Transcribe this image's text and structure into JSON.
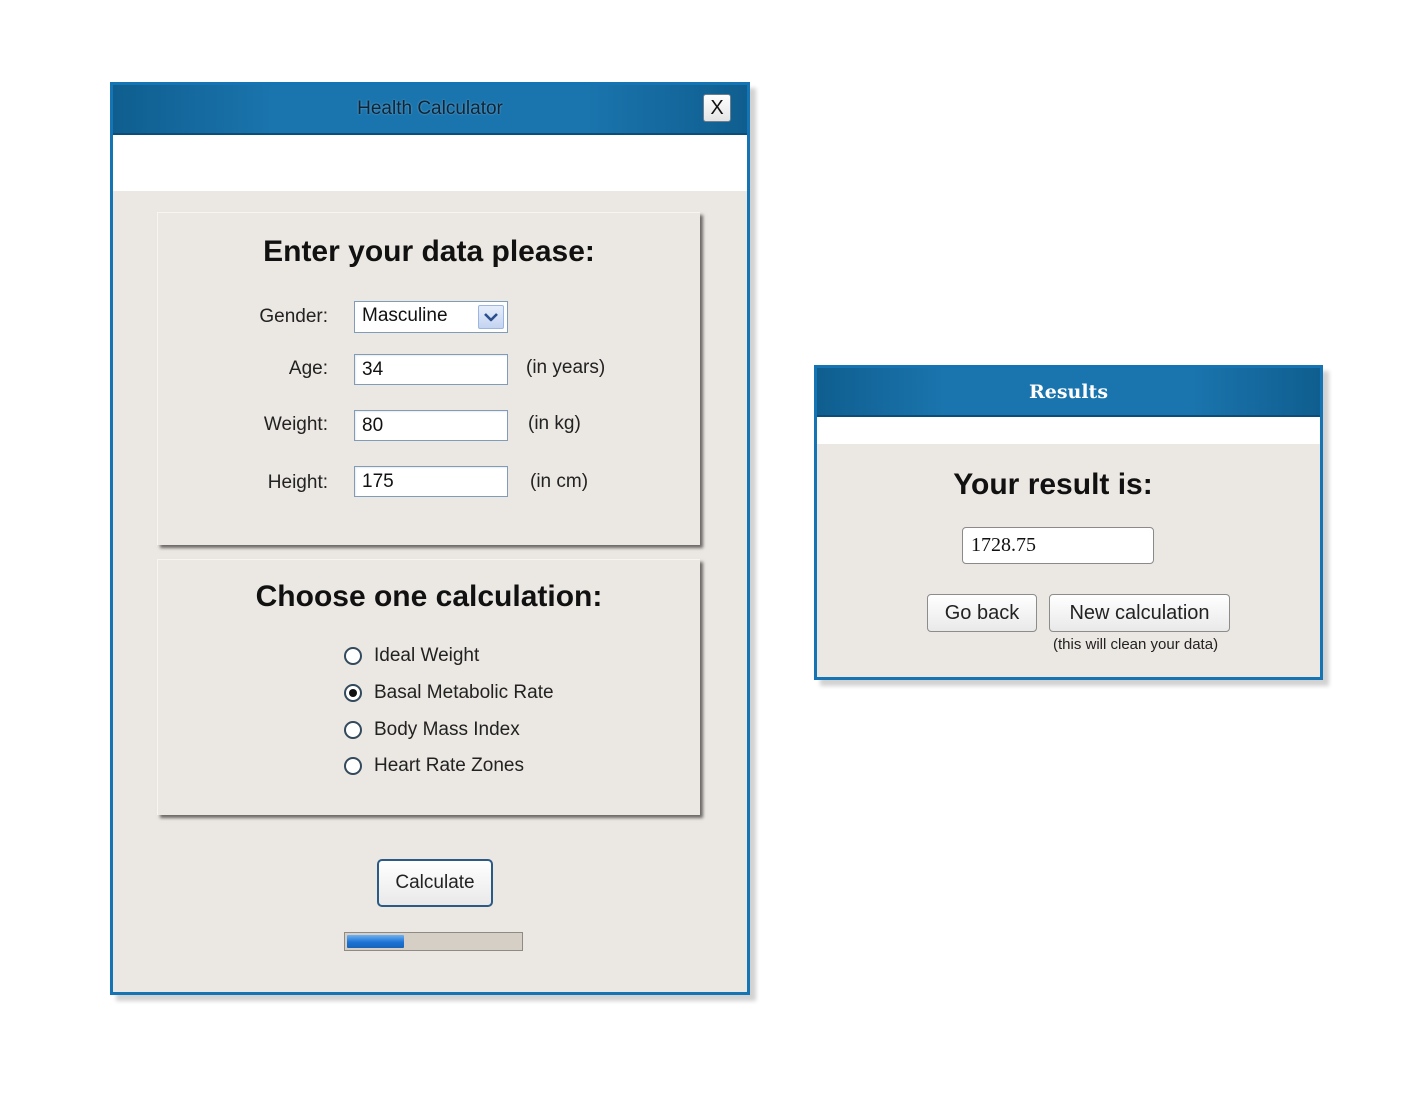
{
  "main_window": {
    "title": "Health Calculator",
    "close_label": "X",
    "data_panel": {
      "heading": "Enter your data please:",
      "gender": {
        "label": "Gender:",
        "value": "Masculine"
      },
      "age": {
        "label": "Age:",
        "value": "34",
        "unit": "(in years)"
      },
      "weight": {
        "label": "Weight:",
        "value": "80",
        "unit": "(in kg)"
      },
      "height": {
        "label": "Height:",
        "value": "175",
        "unit": "(in cm)"
      }
    },
    "calc_panel": {
      "heading": "Choose one calculation:",
      "options": [
        {
          "label": "Ideal Weight",
          "checked": false
        },
        {
          "label": "Basal Metabolic Rate",
          "checked": true
        },
        {
          "label": "Body Mass Index",
          "checked": false
        },
        {
          "label": "Heart Rate Zones",
          "checked": false
        }
      ]
    },
    "calculate_label": "Calculate",
    "progress": 0.33
  },
  "results_window": {
    "title": "Results",
    "heading": "Your result is:",
    "result_value": "1728.75",
    "go_back_label": "Go back",
    "new_calc_label": "New calculation",
    "note": "(this will clean your data)"
  },
  "colors": {
    "titlebar_blue": "#1a74ad",
    "window_border": "#1474b4",
    "panel_bg": "#ebe7e2",
    "progress_fill": "#1c74d6"
  },
  "icons": {
    "dropdown": "chevron-down-icon"
  }
}
